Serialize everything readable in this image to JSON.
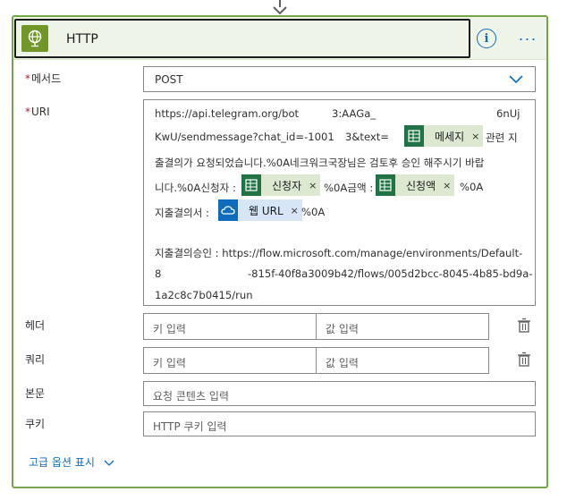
{
  "action": {
    "title": "HTTP",
    "info_icon": "info-icon",
    "more_icon": "more-options-icon",
    "more_label": "···"
  },
  "method": {
    "label": "메서드",
    "value": "POST"
  },
  "uri": {
    "label": "URI",
    "line1": "https://api.telegram.org/bot",
    "line1b": "3:AAGa_",
    "line1c": "6nUj",
    "line2a": "KwU/sendmessage?chat_id=-1001",
    "line2b": "3&text=",
    "line2c": "관련 지",
    "line3": "출결의가 요청되었습니다.%0A네크워크국장님은 검토후 승인 해주시기 바랍",
    "line4a": "니다.%0A신청자 :",
    "line4b": "%0A금액 :",
    "line4c": "%0A",
    "line5a": "지출결의서 :",
    "line5b": "%0A",
    "line7": "지출결의승인 : https://flow.microsoft.com/manage/environments/Default-",
    "line8a": "8",
    "line8b": "-815f-40f8a3009b42/flows/005d2bcc-8045-4b85-bd9a-",
    "line9": "1a2c8c7b0415/run",
    "tokens": {
      "message": "메세지",
      "applicant": "신청자",
      "amount": "신청액",
      "weburl": "웹 URL"
    },
    "token_remove": "×"
  },
  "headers": {
    "label": "헤더",
    "key_placeholder": "키 입력",
    "value_placeholder": "값 입력"
  },
  "queries": {
    "label": "쿼리",
    "key_placeholder": "키 입력",
    "value_placeholder": "값 입력"
  },
  "body": {
    "label": "본문",
    "placeholder": "요청 콘텐츠 입력"
  },
  "cookie": {
    "label": "쿠키",
    "placeholder": "HTTP 쿠키 입력"
  },
  "advanced": {
    "label": "고급 옵션 표시"
  },
  "colors": {
    "accent_green": "#74a54b",
    "excel_green": "#217346",
    "link_blue": "#0f6cbd",
    "required_red": "#a4262c"
  }
}
